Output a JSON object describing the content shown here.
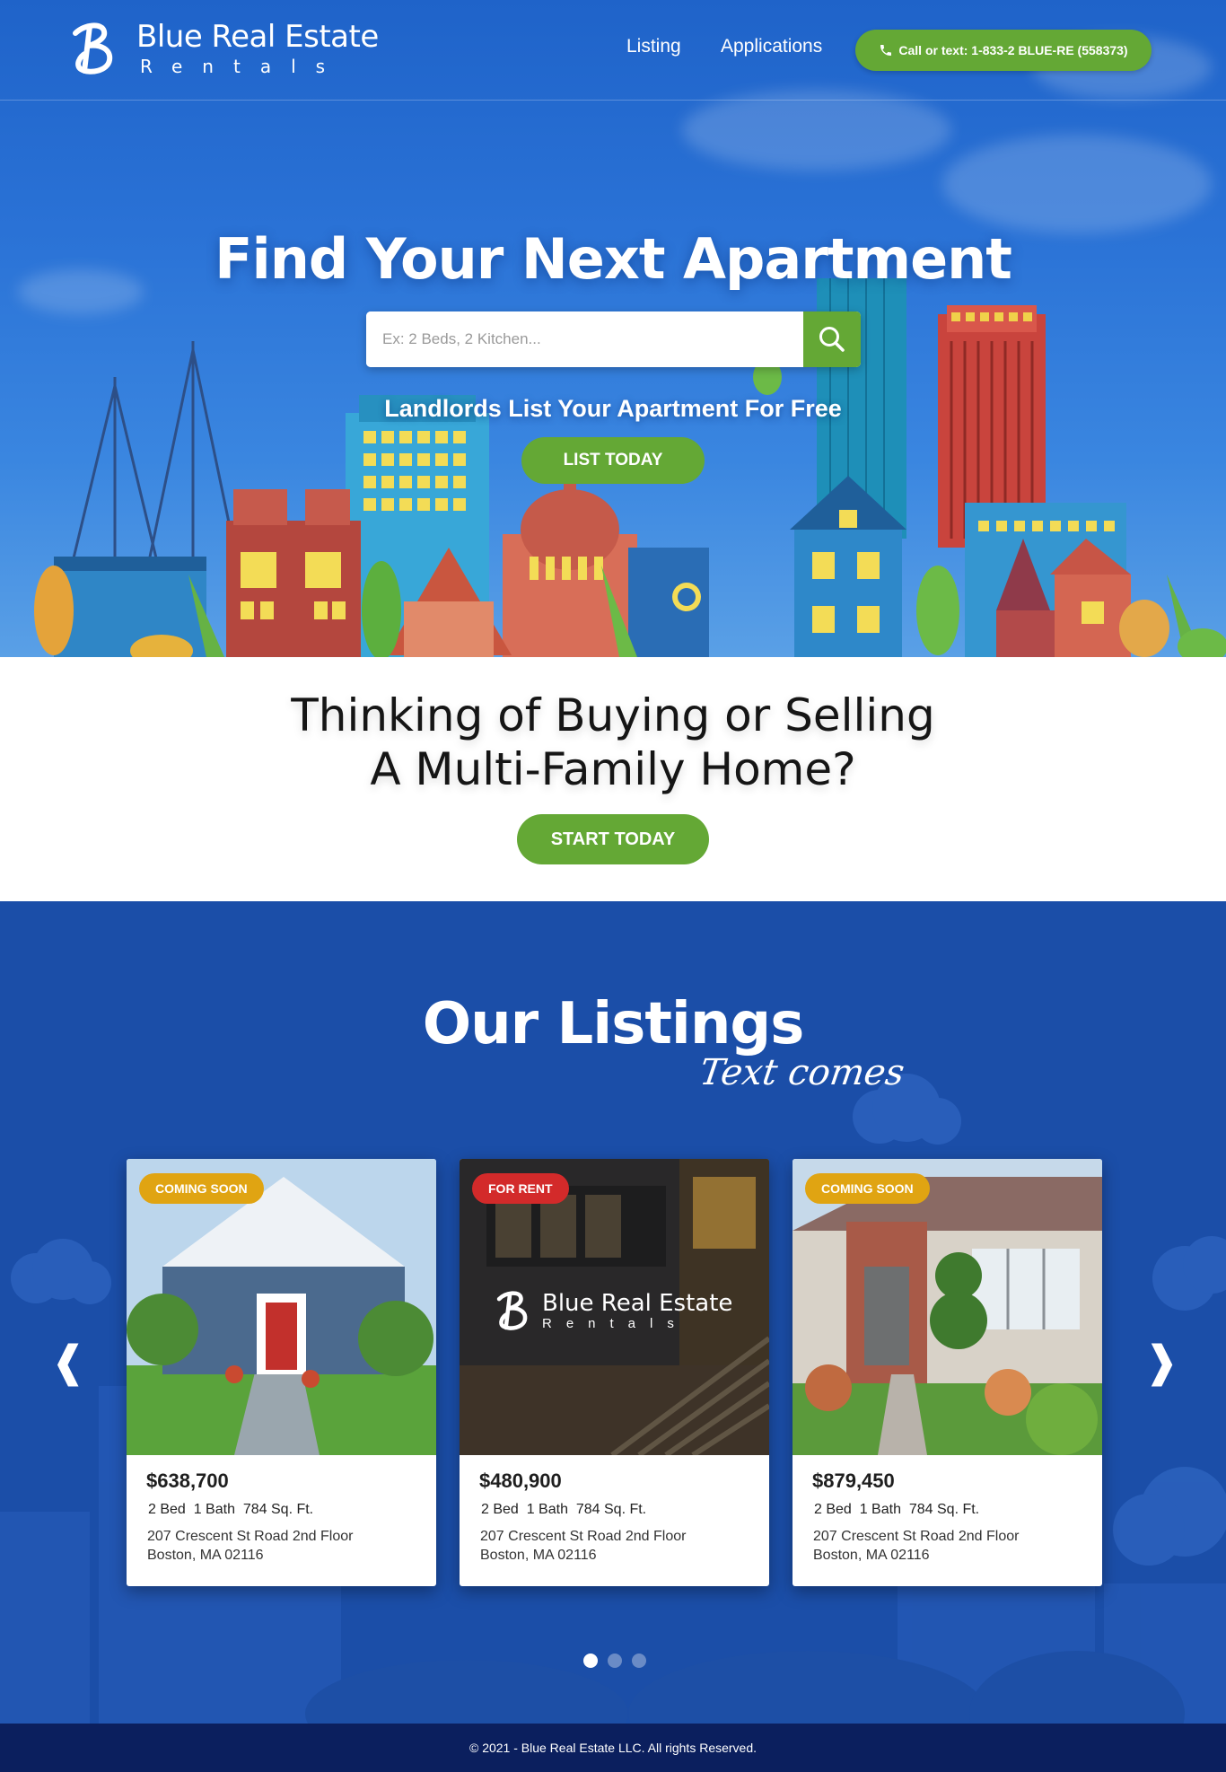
{
  "header": {
    "logo_title": "Blue Real Estate",
    "logo_sub": "Rentals",
    "nav": [
      {
        "label": "Listing"
      },
      {
        "label": "Applications"
      }
    ],
    "call_label": "Call or text: 1-833-2 BLUE-RE (558373)"
  },
  "hero": {
    "title": "Find Your Next Apartment",
    "search_placeholder": "Ex: 2 Beds, 2 Kitchen...",
    "landlord_text": "Landlords List Your Apartment For Free",
    "list_button": "LIST TODAY"
  },
  "buy": {
    "line1": "Thinking of Buying or Selling",
    "line2": "A Multi-Family Home?",
    "button": "START TODAY"
  },
  "listings": {
    "title": "Our Listings",
    "subtitle": "Text comes",
    "prev": "❰",
    "next": "❱",
    "cards": [
      {
        "badge": "COMING SOON",
        "badge_color": "#e0a412",
        "price": "$638,700",
        "specs": "2 Bed  1 Bath  784 Sq. Ft.",
        "addr1": "207 Crescent St Road 2nd Floor",
        "addr2": "Boston, MA 02116"
      },
      {
        "badge": "FOR RENT",
        "badge_color": "#d32a2a",
        "price": "$480,900",
        "specs": "2 Bed  1 Bath  784 Sq. Ft.",
        "addr1": "207 Crescent St Road 2nd Floor",
        "addr2": "Boston, MA 02116",
        "overlay_title": "Blue Real Estate",
        "overlay_sub": "Rentals"
      },
      {
        "badge": "COMING SOON",
        "badge_color": "#e0a412",
        "price": "$879,450",
        "specs": "2 Bed  1 Bath  784 Sq. Ft.",
        "addr1": "207 Crescent St Road 2nd Floor",
        "addr2": "Boston, MA 02116"
      }
    ],
    "active_slide": 1,
    "slide_count": 3
  },
  "footer": {
    "copyright": "© 2021 - Blue Real Estate LLC. All rights Reserved."
  },
  "colors": {
    "primary_blue": "#1f63c9",
    "listing_blue": "#1b4ea8",
    "accent_green": "#64a835",
    "footer_navy": "#0b1f5e",
    "badge_gold": "#e0a412",
    "badge_red": "#d32a2a"
  }
}
